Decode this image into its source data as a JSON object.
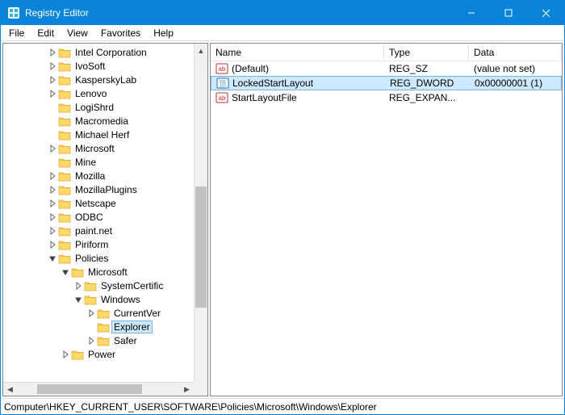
{
  "window": {
    "title": "Registry Editor"
  },
  "menu": {
    "file": "File",
    "edit": "Edit",
    "view": "View",
    "favorites": "Favorites",
    "help": "Help"
  },
  "tree": {
    "items": [
      {
        "indent": 3,
        "exp": "closed",
        "label": "Intel Corporation"
      },
      {
        "indent": 3,
        "exp": "closed",
        "label": "IvoSoft"
      },
      {
        "indent": 3,
        "exp": "closed",
        "label": "KasperskyLab"
      },
      {
        "indent": 3,
        "exp": "closed",
        "label": "Lenovo"
      },
      {
        "indent": 3,
        "exp": "none",
        "label": "LogiShrd"
      },
      {
        "indent": 3,
        "exp": "none",
        "label": "Macromedia"
      },
      {
        "indent": 3,
        "exp": "none",
        "label": "Michael Herf"
      },
      {
        "indent": 3,
        "exp": "closed",
        "label": "Microsoft"
      },
      {
        "indent": 3,
        "exp": "none",
        "label": "Mine"
      },
      {
        "indent": 3,
        "exp": "closed",
        "label": "Mozilla"
      },
      {
        "indent": 3,
        "exp": "closed",
        "label": "MozillaPlugins"
      },
      {
        "indent": 3,
        "exp": "closed",
        "label": "Netscape"
      },
      {
        "indent": 3,
        "exp": "closed",
        "label": "ODBC"
      },
      {
        "indent": 3,
        "exp": "closed",
        "label": "paint.net"
      },
      {
        "indent": 3,
        "exp": "closed",
        "label": "Piriform"
      },
      {
        "indent": 3,
        "exp": "open",
        "label": "Policies"
      },
      {
        "indent": 4,
        "exp": "open",
        "label": "Microsoft"
      },
      {
        "indent": 5,
        "exp": "closed",
        "label": "SystemCertific"
      },
      {
        "indent": 5,
        "exp": "open",
        "label": "Windows"
      },
      {
        "indent": 6,
        "exp": "closed",
        "label": "CurrentVer"
      },
      {
        "indent": 6,
        "exp": "none",
        "label": "Explorer",
        "selected": true
      },
      {
        "indent": 6,
        "exp": "closed",
        "label": "Safer"
      },
      {
        "indent": 4,
        "exp": "closed",
        "label": "Power"
      }
    ]
  },
  "list": {
    "columns": {
      "name": "Name",
      "type": "Type",
      "data": "Data"
    },
    "rows": [
      {
        "icon": "string",
        "name": "(Default)",
        "type": "REG_SZ",
        "data": "(value not set)",
        "selected": false
      },
      {
        "icon": "binary",
        "name": "LockedStartLayout",
        "type": "REG_DWORD",
        "data": "0x00000001 (1)",
        "selected": true
      },
      {
        "icon": "string",
        "name": "StartLayoutFile",
        "type": "REG_EXPAN...",
        "data": "",
        "selected": false
      }
    ]
  },
  "status": {
    "path": "Computer\\HKEY_CURRENT_USER\\SOFTWARE\\Policies\\Microsoft\\Windows\\Explorer"
  }
}
